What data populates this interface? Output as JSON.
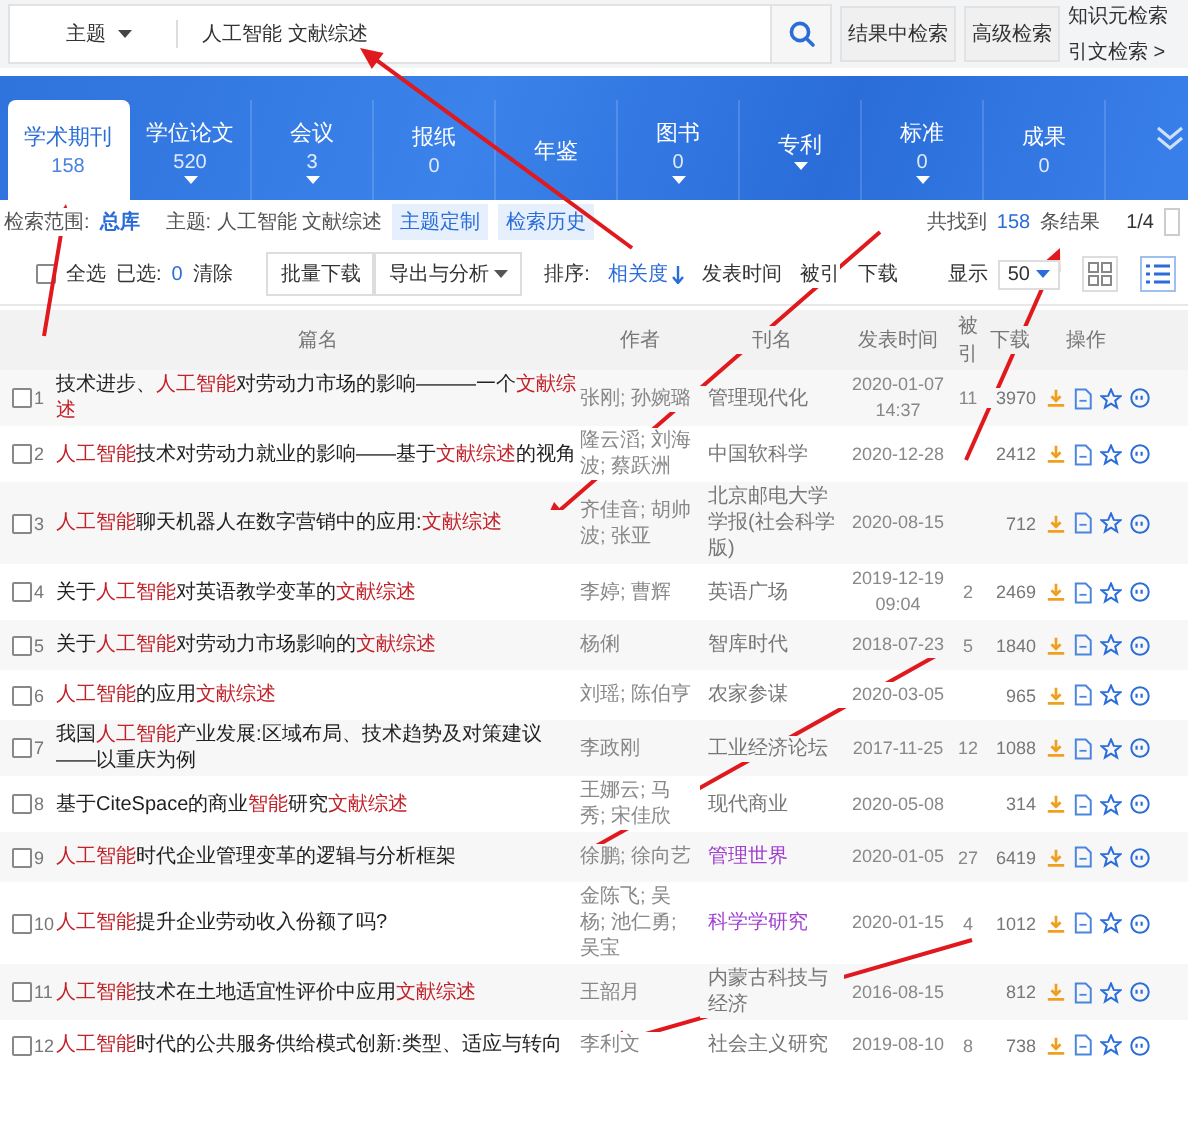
{
  "search": {
    "field_type": "主题",
    "value": "人工智能 文献综述",
    "buttons": [
      "结果中检索",
      "高级检索"
    ],
    "links": [
      "知识元检索",
      "引文检索 >"
    ]
  },
  "tabs": [
    {
      "label": "学术期刊",
      "count": "158",
      "caret": false,
      "selected": true
    },
    {
      "label": "学位论文",
      "count": "520",
      "caret": true,
      "selected": false
    },
    {
      "label": "会议",
      "count": "3",
      "caret": true,
      "selected": false
    },
    {
      "label": "报纸",
      "count": "0",
      "caret": false,
      "selected": false
    },
    {
      "label": "年鉴",
      "caret": false,
      "selected": false
    },
    {
      "label": "图书",
      "count": "0",
      "caret": true,
      "selected": false
    },
    {
      "label": "专利",
      "caret": true,
      "selected": false
    },
    {
      "label": "标准",
      "count": "0",
      "caret": true,
      "selected": false
    },
    {
      "label": "成果",
      "count": "0",
      "caret": false,
      "selected": false
    }
  ],
  "filter": {
    "scope_label": "检索范围:",
    "scope": "总库",
    "topic": "主题: 人工智能 文献综述",
    "buttons": [
      "主题定制",
      "检索历史"
    ],
    "found_prefix": "共找到",
    "found_count": "158",
    "found_suffix": "条结果",
    "page": "1/4"
  },
  "toolbar": {
    "select_all": "全选",
    "select_all_checked": false,
    "selected_label": "已选:",
    "selected_count": "0",
    "clear": "清除",
    "buttons": [
      "批量下载",
      "导出与分析"
    ],
    "sort_label": "排序:",
    "sort_options": [
      {
        "label": "相关度",
        "selected": true
      },
      {
        "label": "发表时间",
        "selected": false
      },
      {
        "label": "被引",
        "selected": false
      },
      {
        "label": "下载",
        "selected": false
      }
    ],
    "display_label": "显示",
    "page_size": "50",
    "views": [
      {
        "kind": "grid",
        "selected": false
      },
      {
        "kind": "list",
        "selected": true
      }
    ]
  },
  "table": {
    "columns": [
      "篇名",
      "作者",
      "刊名",
      "发表时间",
      "被引",
      "下载",
      "操作"
    ],
    "rows": [
      {
        "index": "1",
        "checked": false,
        "title": [
          {
            "text": "技术进步、"
          },
          {
            "text": "人工智能",
            "highlight": true
          },
          {
            "text": "对劳动力市场的影响———一个"
          },
          {
            "text": "文献综述",
            "highlight": true
          }
        ],
        "authors": "张刚; 孙婉璐",
        "journal": "管理现代化",
        "visited": false,
        "date": "2020-01-07 14:37",
        "cited": "11",
        "downloads": "3970"
      },
      {
        "index": "2",
        "checked": false,
        "title": [
          {
            "text": "人工智能",
            "highlight": true
          },
          {
            "text": "技术对劳动力就业的影响——基于"
          },
          {
            "text": "文献综述",
            "highlight": true
          },
          {
            "text": "的视角"
          }
        ],
        "authors": "隆云滔; 刘海波; 蔡跃洲",
        "journal": "中国软科学",
        "visited": false,
        "date": "2020-12-28",
        "downloads": "2412"
      },
      {
        "index": "3",
        "checked": false,
        "title": [
          {
            "text": "人工智能",
            "highlight": true
          },
          {
            "text": "聊天机器人在数字营销中的应用:"
          },
          {
            "text": "文献综述",
            "highlight": true
          }
        ],
        "authors": "齐佳音; 胡帅波; 张亚",
        "journal": "北京邮电大学学报(社会科学版)",
        "visited": false,
        "date": "2020-08-15",
        "downloads": "712"
      },
      {
        "index": "4",
        "checked": false,
        "title": [
          {
            "text": "关于"
          },
          {
            "text": "人工智能",
            "highlight": true
          },
          {
            "text": "对英语教学变革的"
          },
          {
            "text": "文献综述",
            "highlight": true
          }
        ],
        "authors": "李婷; 曹辉",
        "journal": "英语广场",
        "visited": false,
        "date": "2019-12-19 09:04",
        "cited": "2",
        "downloads": "2469"
      },
      {
        "index": "5",
        "checked": false,
        "title": [
          {
            "text": "关于"
          },
          {
            "text": "人工智能",
            "highlight": true
          },
          {
            "text": "对劳动力市场影响的"
          },
          {
            "text": "文献综述",
            "highlight": true
          }
        ],
        "authors": "杨俐",
        "journal": "智库时代",
        "visited": false,
        "date": "2018-07-23",
        "cited": "5",
        "downloads": "1840"
      },
      {
        "index": "6",
        "checked": false,
        "title": [
          {
            "text": "人工智能",
            "highlight": true
          },
          {
            "text": "的应用"
          },
          {
            "text": "文献综述",
            "highlight": true
          }
        ],
        "authors": "刘瑶; 陈伯亨",
        "journal": "农家参谋",
        "visited": false,
        "date": "2020-03-05",
        "downloads": "965"
      },
      {
        "index": "7",
        "checked": false,
        "title": [
          {
            "text": "我国"
          },
          {
            "text": "人工智能",
            "highlight": true
          },
          {
            "text": "产业发展:区域布局、技术趋势及对策建议——以重庆为例"
          }
        ],
        "authors": "李政刚",
        "journal": "工业经济论坛",
        "visited": false,
        "date": "2017-11-25",
        "cited": "12",
        "downloads": "1088"
      },
      {
        "index": "8",
        "checked": false,
        "title": [
          {
            "text": "基于CiteSpace的商业"
          },
          {
            "text": "智能",
            "highlight": true
          },
          {
            "text": "研究"
          },
          {
            "text": "文献综述",
            "highlight": true
          }
        ],
        "authors": "王娜云; 马秀; 宋佳欣",
        "journal": "现代商业",
        "visited": false,
        "date": "2020-05-08",
        "downloads": "314"
      },
      {
        "index": "9",
        "checked": false,
        "title": [
          {
            "text": "人工智能",
            "highlight": true
          },
          {
            "text": "时代企业管理变革的逻辑与分析框架"
          }
        ],
        "authors": "徐鹏; 徐向艺",
        "journal": "管理世界",
        "visited": true,
        "date": "2020-01-05",
        "cited": "27",
        "downloads": "6419"
      },
      {
        "index": "10",
        "checked": false,
        "title": [
          {
            "text": "人工智能",
            "highlight": true
          },
          {
            "text": "提升企业劳动收入份额了吗?"
          }
        ],
        "authors": "金陈飞; 吴杨; 池仁勇; 吴宝",
        "journal": "科学学研究",
        "visited": true,
        "date": "2020-01-15",
        "cited": "4",
        "downloads": "1012"
      },
      {
        "index": "11",
        "checked": false,
        "title": [
          {
            "text": "人工智能",
            "highlight": true
          },
          {
            "text": "技术在土地适宜性评价中应用"
          },
          {
            "text": "文献综述",
            "highlight": true
          }
        ],
        "authors": "王韶月",
        "journal": "内蒙古科技与经济",
        "visited": false,
        "date": "2016-08-15",
        "downloads": "812"
      },
      {
        "index": "12",
        "checked": false,
        "title": [
          {
            "text": "人工智能",
            "highlight": true
          },
          {
            "text": "时代的公共服务供给模式创新:类型、适应与转向"
          }
        ],
        "authors": "李利文",
        "journal": "社会主义研究",
        "visited": false,
        "date": "2019-08-10",
        "cited": "8",
        "downloads": "738"
      }
    ]
  }
}
